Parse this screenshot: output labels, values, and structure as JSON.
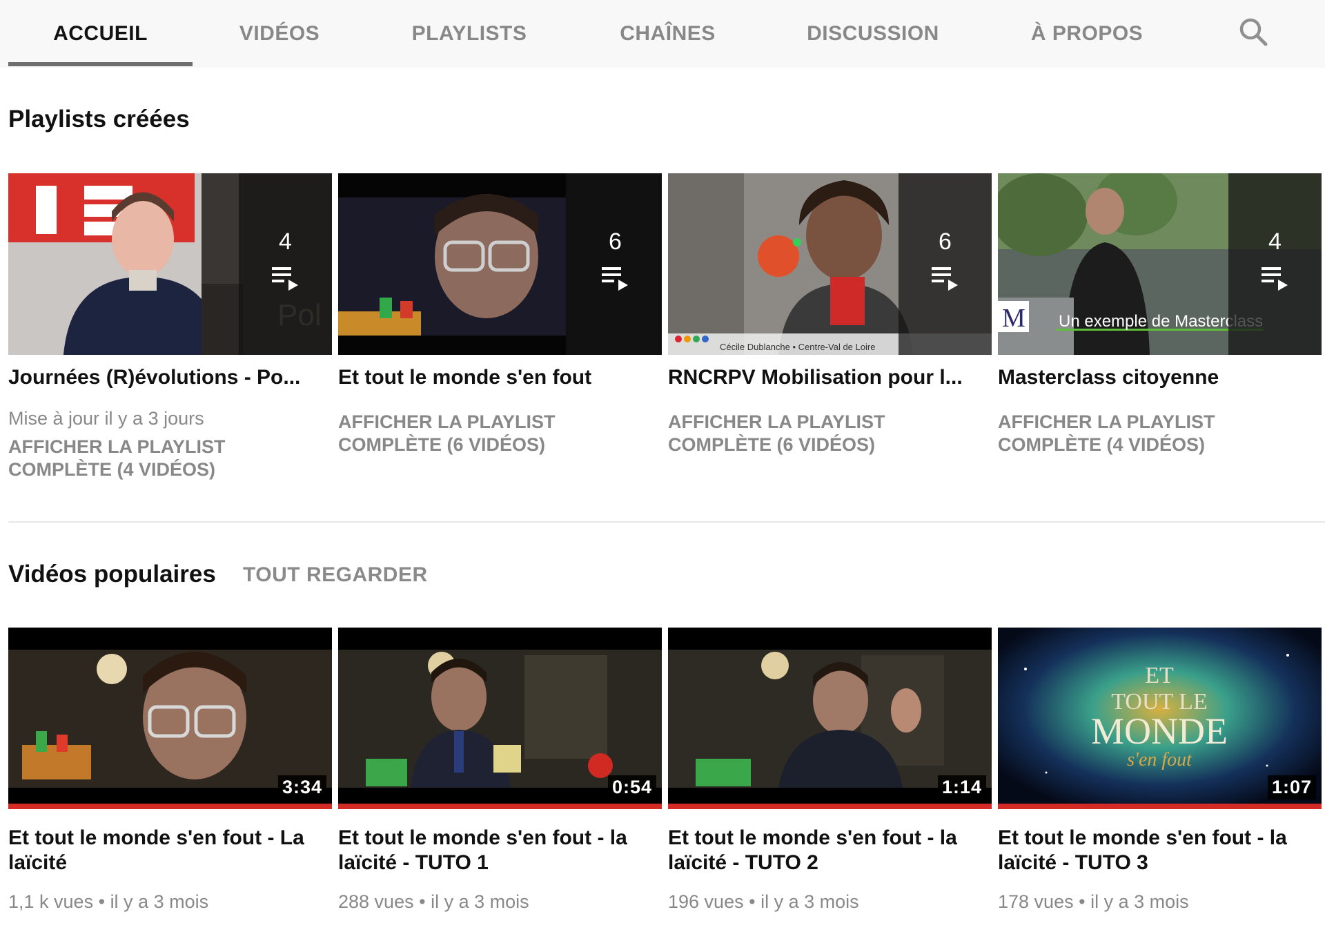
{
  "tabs": [
    {
      "label": "ACCUEIL",
      "active": true
    },
    {
      "label": "VIDÉOS",
      "active": false
    },
    {
      "label": "PLAYLISTS",
      "active": false
    },
    {
      "label": "CHAÎNES",
      "active": false
    },
    {
      "label": "DISCUSSION",
      "active": false
    },
    {
      "label": "À PROPOS",
      "active": false
    }
  ],
  "search_icon": "search-icon",
  "playlists_section": {
    "title": "Playlists créées",
    "items": [
      {
        "count": "4",
        "title": "Journées (R)évolutions - Po...",
        "updated": "Mise à jour il y a 3 jours",
        "link": "AFFICHER LA PLAYLIST COMPLÈTE (4 VIDÉOS)"
      },
      {
        "count": "6",
        "title": "Et tout le monde s'en fout",
        "link": "AFFICHER LA PLAYLIST COMPLÈTE (6 VIDÉOS)"
      },
      {
        "count": "6",
        "title": "RNCRPV Mobilisation pour l...",
        "thumb_caption": "Cécile Dublanche • Centre-Val de Loire",
        "link": "AFFICHER LA PLAYLIST COMPLÈTE (6 VIDÉOS)"
      },
      {
        "count": "4",
        "title": "Masterclass citoyenne",
        "thumb_caption": "Un exemple de Masterclass",
        "thumb_logo": "M",
        "link": "AFFICHER LA PLAYLIST COMPLÈTE (4 VIDÉOS)"
      }
    ]
  },
  "videos_section": {
    "title": "Vidéos populaires",
    "see_all": "TOUT REGARDER",
    "items": [
      {
        "duration": "3:34",
        "title": "Et tout le monde s'en fout - La laïcité",
        "views": "1,1 k vues",
        "age": "il y a 3 mois"
      },
      {
        "duration": "0:54",
        "title": "Et tout le monde s'en fout - la laïcité - TUTO 1",
        "views": "288 vues",
        "age": "il y a 3 mois"
      },
      {
        "duration": "1:14",
        "title": "Et tout le monde s'en fout - la laïcité - TUTO 2",
        "views": "196 vues",
        "age": "il y a 3 mois"
      },
      {
        "duration": "1:07",
        "title": "Et tout le monde s'en fout - la laïcité - TUTO 3",
        "views": "178 vues",
        "age": "il y a 3 mois",
        "thumb_text": [
          "ET",
          "TOUT LE",
          "MONDE",
          "s'en fout"
        ]
      }
    ]
  },
  "meta_separator": "•",
  "colors": {
    "progress_red": "#d32a25",
    "tab_indicator": "#6e6e6e",
    "muted_text": "#888888"
  }
}
